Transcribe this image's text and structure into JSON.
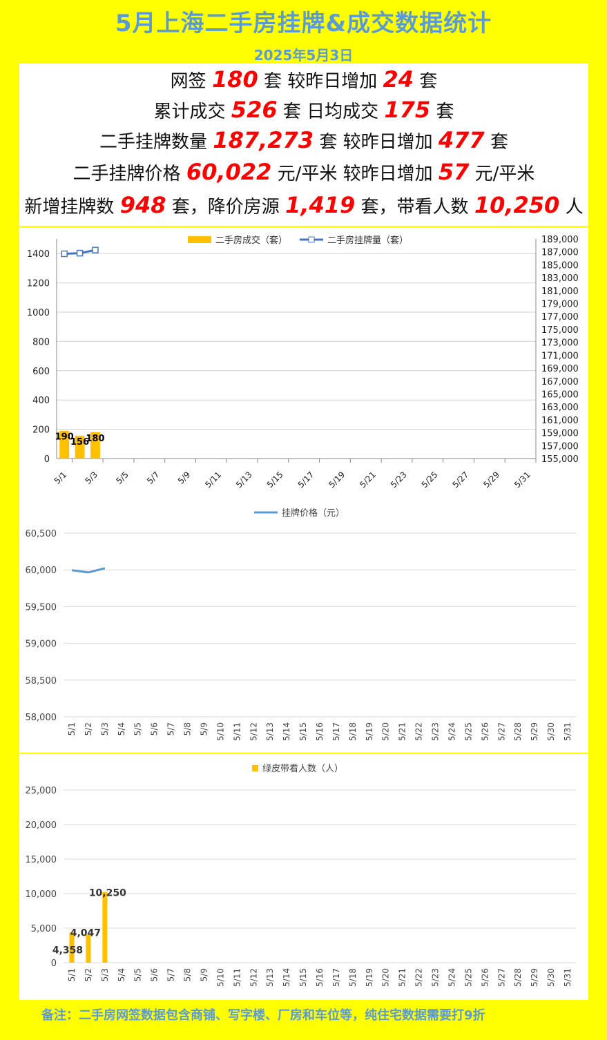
{
  "page": {
    "title": "5月上海二手房挂牌&成交数据统计",
    "date": "2025年5月3日",
    "footer": "备注：二手房网签数据包含商铺、写字楼、厂房和车位等，纯住宅数据需要打9折",
    "colors": {
      "background": "#FFFF00",
      "title": "#5B9BD5",
      "highlight": "#FF0000",
      "bar": "#FFC000",
      "line": "#4472C4",
      "price_line": "#5B9BD5"
    }
  },
  "stats": {
    "l1": {
      "a": "网签",
      "v1": "180",
      "b": "套 较昨日增加",
      "v2": "24",
      "c": "套"
    },
    "l2": {
      "a": "累计成交",
      "v1": "526",
      "b": "套 日均成交",
      "v2": "175",
      "c": "套"
    },
    "l3": {
      "a": "二手挂牌数量",
      "v1": "187,273",
      "b": "套 较昨日增加",
      "v2": "477",
      "c": "套"
    },
    "l4": {
      "a": "二手挂牌价格",
      "v1": "60,022",
      "b": "元/平米 较昨日增加",
      "v2": "57",
      "c": "元/平米"
    },
    "l5": {
      "a": "新增挂牌数",
      "v1": "948",
      "b": "套，降价房源",
      "v2": "1,419",
      "c": "套，带看人数",
      "v3": "10,250",
      "d": "人"
    }
  },
  "chart_data": [
    {
      "type": "bar",
      "legend": [
        "二手房成交（套）",
        "二手房挂牌量（套）"
      ],
      "legend_position": "top",
      "x_ticks": [
        "5/1",
        "5/3",
        "5/5",
        "5/7",
        "5/9",
        "5/11",
        "5/13",
        "5/15",
        "5/17",
        "5/19",
        "5/21",
        "5/23",
        "5/25",
        "5/27",
        "5/29",
        "5/31"
      ],
      "x_count": 31,
      "y_ticks": [
        "0",
        "200",
        "400",
        "600",
        "800",
        "1000",
        "1200",
        "1400"
      ],
      "y2_ticks": [
        "155,000",
        "157,000",
        "159,000",
        "161,000",
        "163,000",
        "165,000",
        "167,000",
        "169,000",
        "171,000",
        "173,000",
        "175,000",
        "177,000",
        "179,000",
        "181,000",
        "183,000",
        "185,000",
        "187,000",
        "189,000"
      ],
      "ylim": [
        0,
        1500
      ],
      "y2lim": [
        155000,
        189000
      ],
      "grid": true,
      "series": [
        {
          "name": "二手房成交（套）",
          "type": "bar",
          "axis": "left",
          "x": [
            1,
            2,
            3
          ],
          "values": [
            190,
            156,
            180
          ],
          "labels": [
            "190",
            "156",
            "180"
          ]
        },
        {
          "name": "二手房挂牌量（套）",
          "type": "line",
          "axis": "right",
          "x": [
            1,
            2,
            3
          ],
          "values": [
            186700,
            186800,
            187273
          ]
        }
      ]
    },
    {
      "type": "line",
      "legend": [
        "挂牌价格（元）"
      ],
      "legend_position": "top",
      "x_ticks": [
        "5/1",
        "5/2",
        "5/3",
        "5/4",
        "5/5",
        "5/6",
        "5/7",
        "5/8",
        "5/9",
        "5/10",
        "5/11",
        "5/12",
        "5/13",
        "5/14",
        "5/15",
        "5/16",
        "5/17",
        "5/18",
        "5/19",
        "5/20",
        "5/21",
        "5/22",
        "5/23",
        "5/24",
        "5/25",
        "5/26",
        "5/27",
        "5/28",
        "5/29",
        "5/30",
        "5/31"
      ],
      "y_ticks": [
        "58,000",
        "58,500",
        "59,000",
        "59,500",
        "60,000",
        "60,500"
      ],
      "ylim": [
        58000,
        60500
      ],
      "grid": true,
      "series": [
        {
          "name": "挂牌价格（元）",
          "x": [
            1,
            2,
            3
          ],
          "values": [
            59995,
            59965,
            60022
          ]
        }
      ]
    },
    {
      "type": "bar",
      "legend": [
        "绿皮带看人数（人）"
      ],
      "legend_position": "top",
      "x_ticks": [
        "5/1",
        "5/2",
        "5/3",
        "5/4",
        "5/5",
        "5/6",
        "5/7",
        "5/8",
        "5/9",
        "5/10",
        "5/11",
        "5/12",
        "5/13",
        "5/14",
        "5/15",
        "5/16",
        "5/17",
        "5/18",
        "5/19",
        "5/20",
        "5/21",
        "5/22",
        "5/23",
        "5/24",
        "5/25",
        "5/26",
        "5/27",
        "5/28",
        "5/29",
        "5/30",
        "5/31"
      ],
      "y_ticks": [
        "0",
        "5,000",
        "10,000",
        "15,000",
        "20,000",
        "25,000"
      ],
      "ylim": [
        0,
        25000
      ],
      "grid": true,
      "series": [
        {
          "name": "绿皮带看人数（人）",
          "x": [
            1,
            2,
            3
          ],
          "values": [
            4358,
            4047,
            10250
          ],
          "labels": [
            "4,358",
            "4,047",
            "10,250"
          ]
        }
      ]
    }
  ]
}
